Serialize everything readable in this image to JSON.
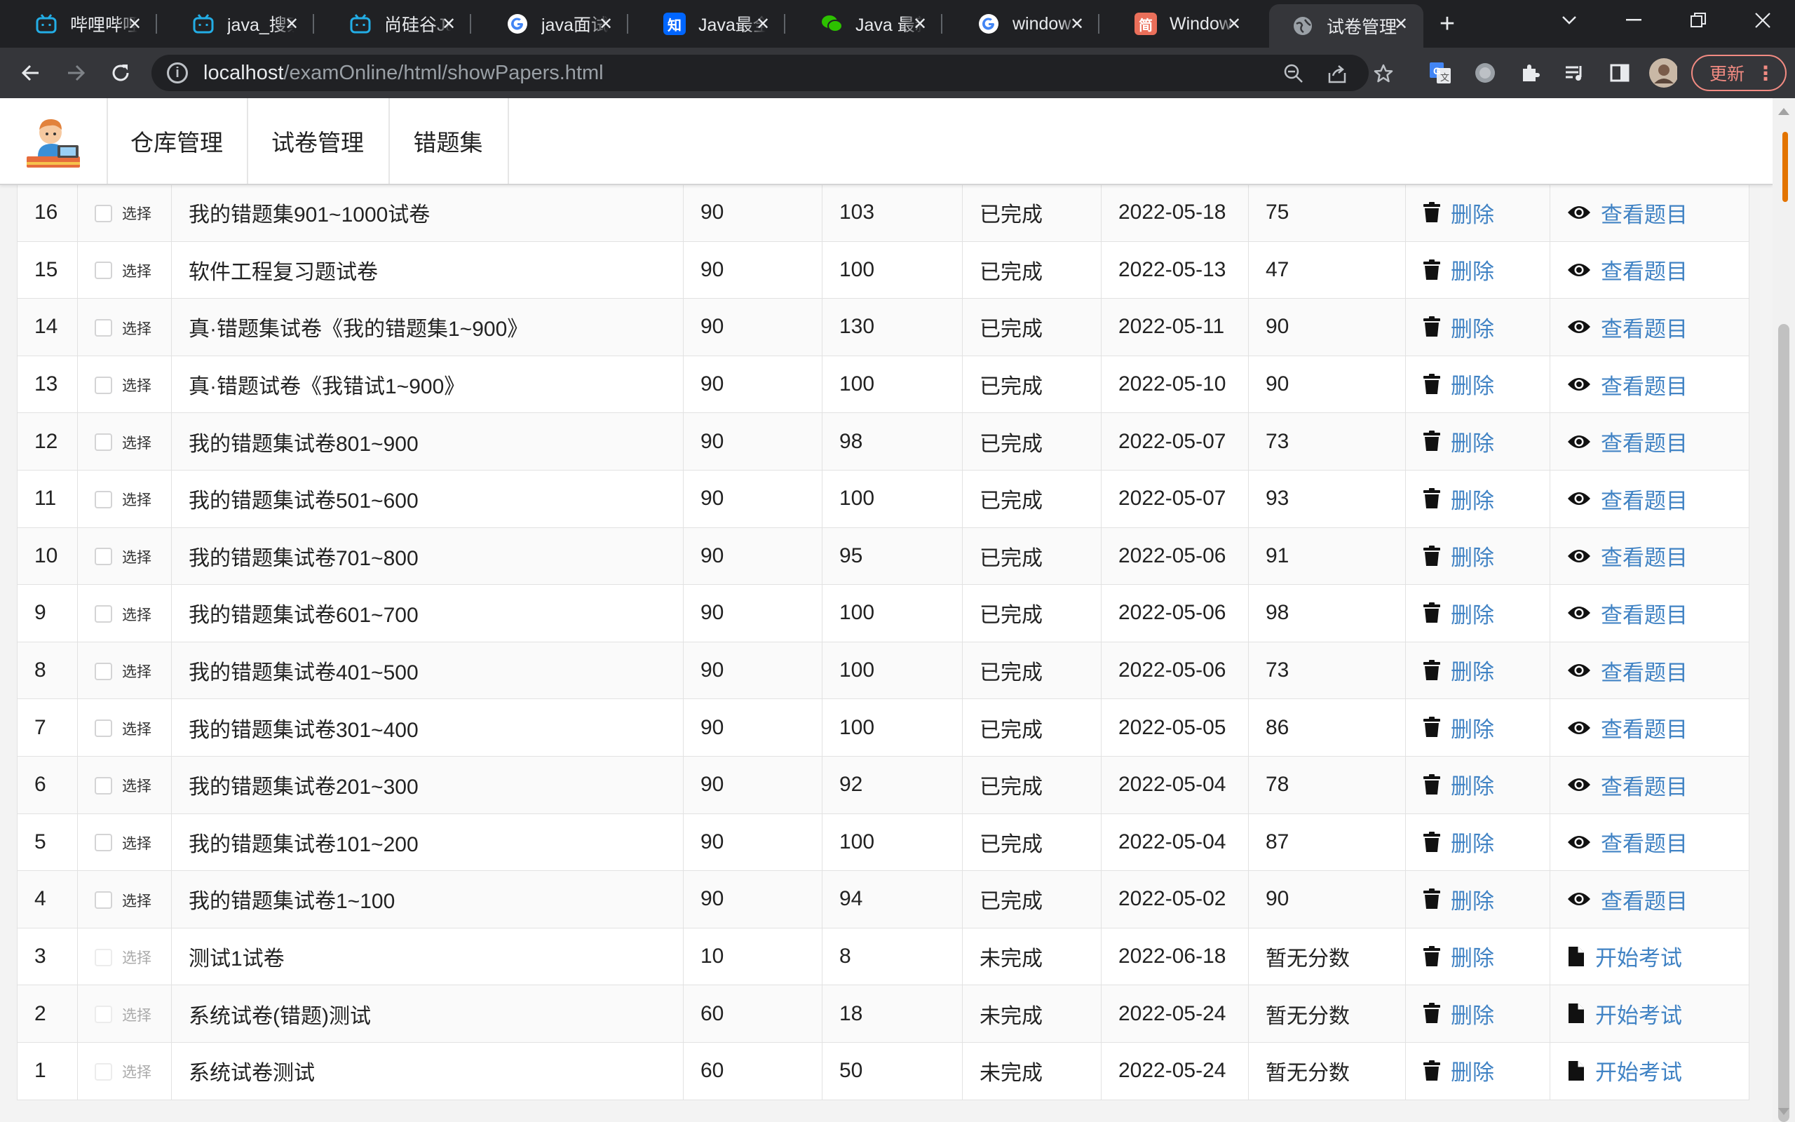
{
  "browser": {
    "tabs": [
      {
        "title": "哔哩哔哩",
        "favicon": "bilibili-icon"
      },
      {
        "title": "java_搜索",
        "favicon": "bilibili-icon"
      },
      {
        "title": "尚硅谷Ja",
        "favicon": "bilibili-icon"
      },
      {
        "title": "java面试",
        "favicon": "google-icon"
      },
      {
        "title": "Java最全",
        "favicon": "zhihu-icon"
      },
      {
        "title": "Java 最新",
        "favicon": "wechat-icon"
      },
      {
        "title": "window",
        "favicon": "google-icon"
      },
      {
        "title": "Window",
        "favicon": "jianshu-icon"
      },
      {
        "title": "试卷管理",
        "favicon": "globe-icon"
      }
    ],
    "url": {
      "host": "localhost",
      "path": "/examOnline/html/showPapers.html"
    },
    "update_label": "更新",
    "colors": {
      "chrome_dark": "#202124",
      "chrome_mid": "#35363a",
      "update": "#f28b82"
    }
  },
  "site_nav": {
    "items": [
      "仓库管理",
      "试卷管理",
      "错题集"
    ]
  },
  "table": {
    "select_label": "选择",
    "delete_label": "删除",
    "view_label": "查看题目",
    "start_label": "开始考试",
    "link_color": "#4183c4",
    "rows": [
      {
        "id": "16",
        "name": "我的错题集901~1000试卷",
        "col3": "90",
        "col4": "103",
        "status": "已完成",
        "date": "2022-05-18",
        "score": "75",
        "action": "查看题目"
      },
      {
        "id": "15",
        "name": "软件工程复习题试卷",
        "col3": "90",
        "col4": "100",
        "status": "已完成",
        "date": "2022-05-13",
        "score": "47",
        "action": "查看题目"
      },
      {
        "id": "14",
        "name": "真·错题集试卷《我的错题集1~900》",
        "col3": "90",
        "col4": "130",
        "status": "已完成",
        "date": "2022-05-11",
        "score": "90",
        "action": "查看题目"
      },
      {
        "id": "13",
        "name": "真·错题试卷《我错试1~900》",
        "col3": "90",
        "col4": "100",
        "status": "已完成",
        "date": "2022-05-10",
        "score": "90",
        "action": "查看题目"
      },
      {
        "id": "12",
        "name": "我的错题集试卷801~900",
        "col3": "90",
        "col4": "98",
        "status": "已完成",
        "date": "2022-05-07",
        "score": "73",
        "action": "查看题目"
      },
      {
        "id": "11",
        "name": "我的错题集试卷501~600",
        "col3": "90",
        "col4": "100",
        "status": "已完成",
        "date": "2022-05-07",
        "score": "93",
        "action": "查看题目"
      },
      {
        "id": "10",
        "name": "我的错题集试卷701~800",
        "col3": "90",
        "col4": "95",
        "status": "已完成",
        "date": "2022-05-06",
        "score": "91",
        "action": "查看题目"
      },
      {
        "id": "9",
        "name": "我的错题集试卷601~700",
        "col3": "90",
        "col4": "100",
        "status": "已完成",
        "date": "2022-05-06",
        "score": "98",
        "action": "查看题目"
      },
      {
        "id": "8",
        "name": "我的错题集试卷401~500",
        "col3": "90",
        "col4": "100",
        "status": "已完成",
        "date": "2022-05-06",
        "score": "73",
        "action": "查看题目"
      },
      {
        "id": "7",
        "name": "我的错题集试卷301~400",
        "col3": "90",
        "col4": "100",
        "status": "已完成",
        "date": "2022-05-05",
        "score": "86",
        "action": "查看题目"
      },
      {
        "id": "6",
        "name": "我的错题集试卷201~300",
        "col3": "90",
        "col4": "92",
        "status": "已完成",
        "date": "2022-05-04",
        "score": "78",
        "action": "查看题目"
      },
      {
        "id": "5",
        "name": "我的错题集试卷101~200",
        "col3": "90",
        "col4": "100",
        "status": "已完成",
        "date": "2022-05-04",
        "score": "87",
        "action": "查看题目"
      },
      {
        "id": "4",
        "name": "我的错题集试卷1~100",
        "col3": "90",
        "col4": "94",
        "status": "已完成",
        "date": "2022-05-02",
        "score": "90",
        "action": "查看题目"
      },
      {
        "id": "3",
        "name": "测试1试卷",
        "col3": "10",
        "col4": "8",
        "status": "未完成",
        "date": "2022-06-18",
        "score": "暂无分数",
        "action": "开始考试"
      },
      {
        "id": "2",
        "name": "系统试卷(错题)测试",
        "col3": "60",
        "col4": "18",
        "status": "未完成",
        "date": "2022-05-24",
        "score": "暂无分数",
        "action": "开始考试"
      },
      {
        "id": "1",
        "name": "系统试卷测试",
        "col3": "60",
        "col4": "50",
        "status": "未完成",
        "date": "2022-05-24",
        "score": "暂无分数",
        "action": "开始考试"
      }
    ]
  }
}
